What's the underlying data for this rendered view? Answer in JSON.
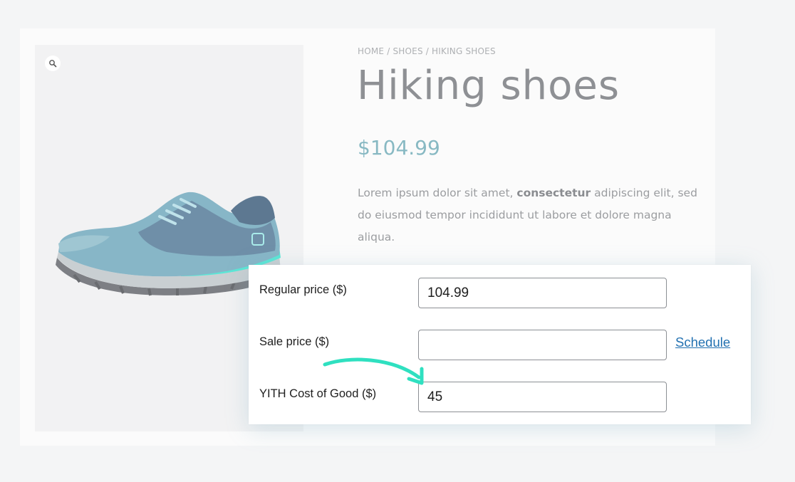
{
  "product": {
    "breadcrumb": "HOME / SHOES / HIKING SHOES",
    "title": "Hiking shoes",
    "price": "$104.99",
    "description_prefix": "Lorem ipsum dolor sit amet, ",
    "description_bold": "consectetur",
    "description_suffix": " adipiscing elit, sed do eiusmod tempor incididunt ut labore et dolore magna aliqua."
  },
  "icons": {
    "zoom": "magnifier-icon",
    "arrow": "curved-arrow-icon"
  },
  "pricing": {
    "regular_price_label": "Regular price ($)",
    "regular_price_value": "104.99",
    "sale_price_label": "Sale price ($)",
    "sale_price_value": "",
    "schedule_link": "Schedule",
    "cost_label": "YITH Cost of Good ($)",
    "cost_value": "45"
  },
  "colors": {
    "price": "#88b9c3",
    "link": "#2271b1",
    "arrow": "#2fe0c0",
    "shoe_upper": "#7fa6bd",
    "shoe_sole_accent": "#5ce6d6"
  }
}
